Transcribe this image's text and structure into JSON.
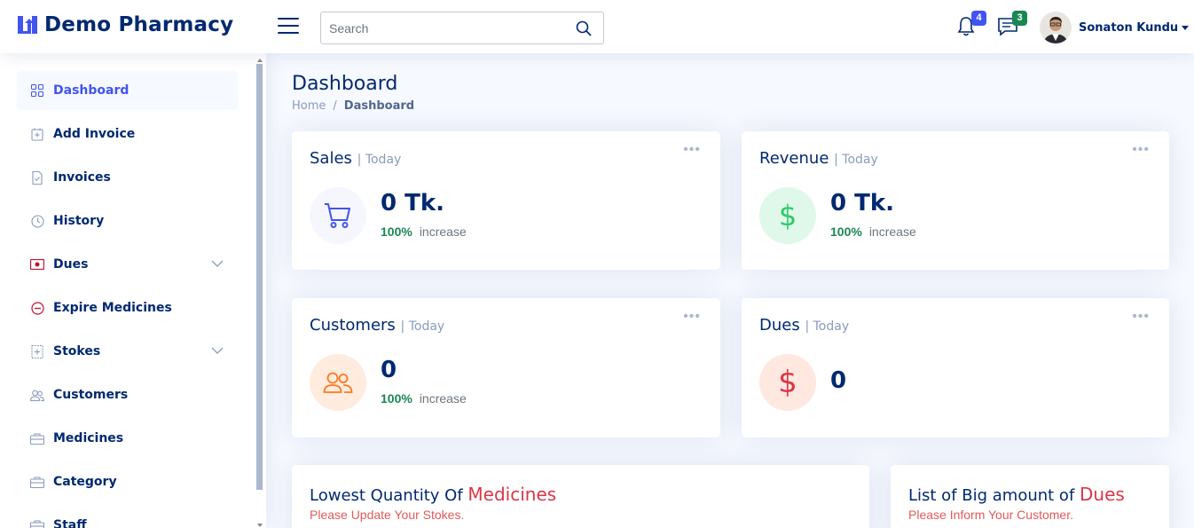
{
  "header": {
    "logo_text": "Demo Pharmacy",
    "search_placeholder": "Search",
    "notifications_count": "4",
    "messages_count": "3",
    "user_name": "Sonaton Kundu"
  },
  "sidebar": {
    "items": [
      {
        "label": "Dashboard",
        "icon": "grid-icon",
        "active": true
      },
      {
        "label": "Add Invoice",
        "icon": "journal-plus-icon"
      },
      {
        "label": "Invoices",
        "icon": "document-icon"
      },
      {
        "label": "History",
        "icon": "clock-icon"
      },
      {
        "label": "Dues",
        "icon": "cash-icon",
        "has_submenu": true
      },
      {
        "label": "Expire Medicines",
        "icon": "dash-circle-icon"
      },
      {
        "label": "Stokes",
        "icon": "box-plus-icon",
        "has_submenu": true
      },
      {
        "label": "Customers",
        "icon": "people-icon"
      },
      {
        "label": "Medicines",
        "icon": "briefcase-icon"
      },
      {
        "label": "Category",
        "icon": "briefcase-icon"
      },
      {
        "label": "Staff",
        "icon": "briefcase-icon"
      }
    ]
  },
  "main": {
    "title": "Dashboard",
    "breadcrumb": {
      "home": "Home",
      "separator": "/",
      "current": "Dashboard"
    },
    "cards": [
      {
        "title": "Sales",
        "period": "| Today",
        "value": "0 Tk.",
        "change_pct": "100%",
        "change_text": "increase",
        "icon": "cart-icon"
      },
      {
        "title": "Revenue",
        "period": "| Today",
        "value": "0 Tk.",
        "change_pct": "100%",
        "change_text": "increase",
        "icon": "dollar-icon"
      },
      {
        "title": "Customers",
        "period": "| Today",
        "value": "0",
        "change_pct": "100%",
        "change_text": "increase",
        "icon": "people-icon"
      },
      {
        "title": "Dues",
        "period": "| Today",
        "value": "0",
        "icon": "dollar-icon"
      }
    ],
    "lowest_qty": {
      "title_prefix": "Lowest Quantity Of ",
      "title_highlight": "Medicines",
      "subtitle": "Please Update Your Stokes."
    },
    "big_dues": {
      "title_prefix": "List of Big amount of ",
      "title_highlight": "Dues",
      "subtitle": "Please Inform Your Customer."
    }
  },
  "colors": {
    "primary": "#4154f1",
    "navy": "#012970",
    "success": "#198754",
    "danger": "#dc3545",
    "revenue_bg": "#e0f8e9",
    "customer_bg": "#ffecdf",
    "dues_bg": "#ffe8e0"
  }
}
